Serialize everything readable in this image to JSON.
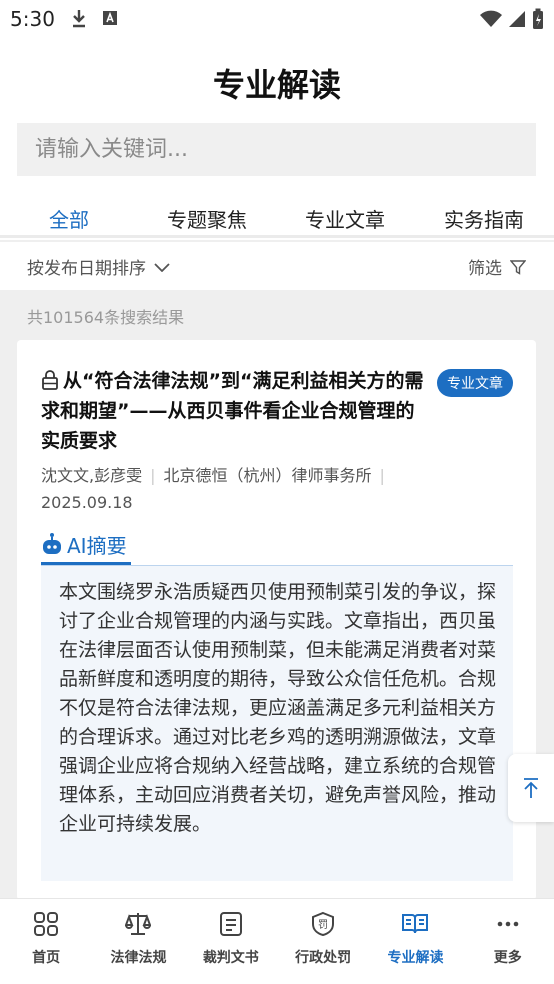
{
  "status": {
    "time": "5:30"
  },
  "page": {
    "title": "专业解读"
  },
  "search": {
    "placeholder": "请输入关键词..."
  },
  "tabs": [
    {
      "label": "全部",
      "active": true
    },
    {
      "label": "专题聚焦"
    },
    {
      "label": "专业文章"
    },
    {
      "label": "实务指南"
    }
  ],
  "sort": {
    "label": "按发布日期排序"
  },
  "filter": {
    "label": "筛选"
  },
  "results": {
    "count_text": "共101564条搜索结果"
  },
  "article": {
    "title": "从“符合法律法规”到“满足利益相关方的需求和期望”——从西贝事件看企业合规管理的实质要求",
    "badge": "专业文章",
    "authors": "沈文文,彭彦雯",
    "firm": "北京德恒（杭州）律师事务所",
    "date": "2025.09.18",
    "ai_label": "AI摘要",
    "summary": "本文围绕罗永浩质疑西贝使用预制菜引发的争议，探讨了企业合规管理的内涵与实践。文章指出，西贝虽在法律层面否认使用预制菜，但未能满足消费者对菜品新鲜度和透明度的期待，导致公众信任危机。合规不仅是符合法律法规，更应涵盖满足多元利益相关方的合理诉求。通过对比老乡鸡的透明溯源做法，文章强调企业应将合规纳入经营战略，建立系统的合规管理体系，主动回应消费者关切，避免声誉风险，推动企业可持续发展。"
  },
  "colors": {
    "accent": "#1d6ec2"
  },
  "bottom_nav": [
    {
      "label": "首页",
      "icon": "home-grid-icon"
    },
    {
      "label": "法律法规",
      "icon": "scale-icon"
    },
    {
      "label": "裁判文书",
      "icon": "document-icon"
    },
    {
      "label": "行政处罚",
      "icon": "penalty-shield-icon"
    },
    {
      "label": "专业解读",
      "icon": "open-book-icon",
      "active": true
    },
    {
      "label": "更多",
      "icon": "more-icon"
    }
  ]
}
